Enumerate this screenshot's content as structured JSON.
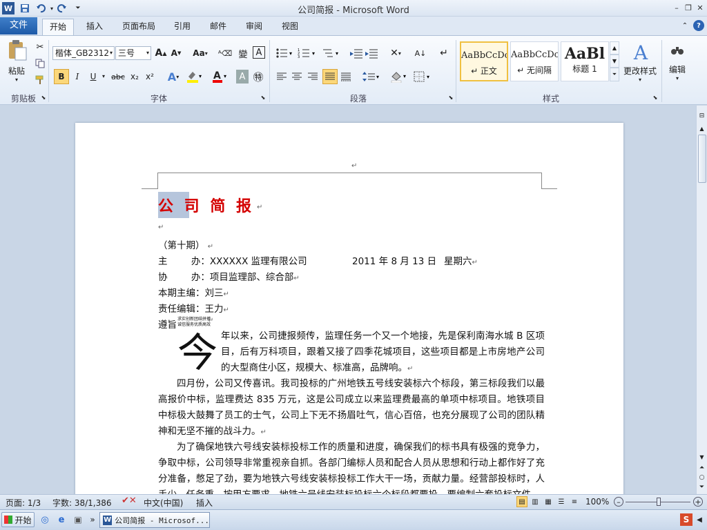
{
  "window": {
    "title": "公司简报  -  Microsoft Word"
  },
  "tabs": {
    "file": "文件",
    "items": [
      "开始",
      "插入",
      "页面布局",
      "引用",
      "邮件",
      "审阅",
      "视图"
    ]
  },
  "ribbon": {
    "clipboard": {
      "paste": "粘贴",
      "group": "剪贴板"
    },
    "font": {
      "name": "楷体_GB2312",
      "size": "三号",
      "group": "字体",
      "aa": "Aa"
    },
    "paragraph": {
      "group": "段落"
    },
    "styles": {
      "group": "样式",
      "items": [
        {
          "preview": "AaBbCcDc",
          "name": "↵ 正文"
        },
        {
          "preview": "AaBbCcDc",
          "name": "↵ 无间隔"
        },
        {
          "preview": "AaBl",
          "name": "标题 1"
        }
      ],
      "change": "更改样式"
    },
    "editing": {
      "label": "编辑"
    }
  },
  "document": {
    "heading": "公 司 简 报",
    "issue": "（第十期）",
    "host_label": "主        办：",
    "host_value": "XXXXXX 监理有限公司",
    "date": "2011 年 8 月  13 日",
    "weekday": "星期六",
    "co_label": "协        办：",
    "co_value": "项目监理部、综合部",
    "editor_label": "本期主编：",
    "editor_value": "刘三",
    "resp_label": "责任编辑：",
    "resp_value": "王力",
    "motto_label": "遵旨",
    "motto_small_1": "求实创新团结拼搏",
    "motto_small_2": "诚信服务优质高效",
    "dropcap": "今",
    "p1": "年以来，公司捷报频传，监理任务一个又一个地接，先是保利南海水城 B 区项目，后有万科项目，跟着又接了四季花城项目，这些项目都是上市房地产公司的大型商住小区，规模大、标准高，品牌响。",
    "p2": "四月份，公司又传喜讯。我司投标的广州地铁五号线安装标六个标段，第三标段我们以最高报价中标，监理费达 835 万元，这是公司成立以来监理费最高的单项中标项目。地铁项目中标极大鼓舞了员工的士气，公司上下无不扬眉吐气，信心百倍，也充分展现了公司的团队精神和无坚不摧的战斗力。",
    "p3": "为了确保地铁六号线安装标投标工作的质量和进度，确保我们的标书具有极强的竞争力，争取中标，公司领导非常重视亲自抓。各部门编标人员和配合人员从思想和行动上都作好了充分准备，憋足了劲，要为地铁六号线安装标投标工作大干一场，贡献力量。经营部投标时，人手少，任务重，按甲方要求，地铁六号线安装标投标六个标段都要投，要编制六套投标文件"
  },
  "status": {
    "page": "页面: 1/3",
    "words": "字数: 38/1,386",
    "lang": "中文(中国)",
    "mode": "插入",
    "zoom": "100%"
  },
  "taskbar": {
    "start": "开始",
    "window": "公司简报 - Microsof..."
  },
  "colors": {
    "heading_red": "#d40000",
    "file_tab": "#2b63b3"
  }
}
